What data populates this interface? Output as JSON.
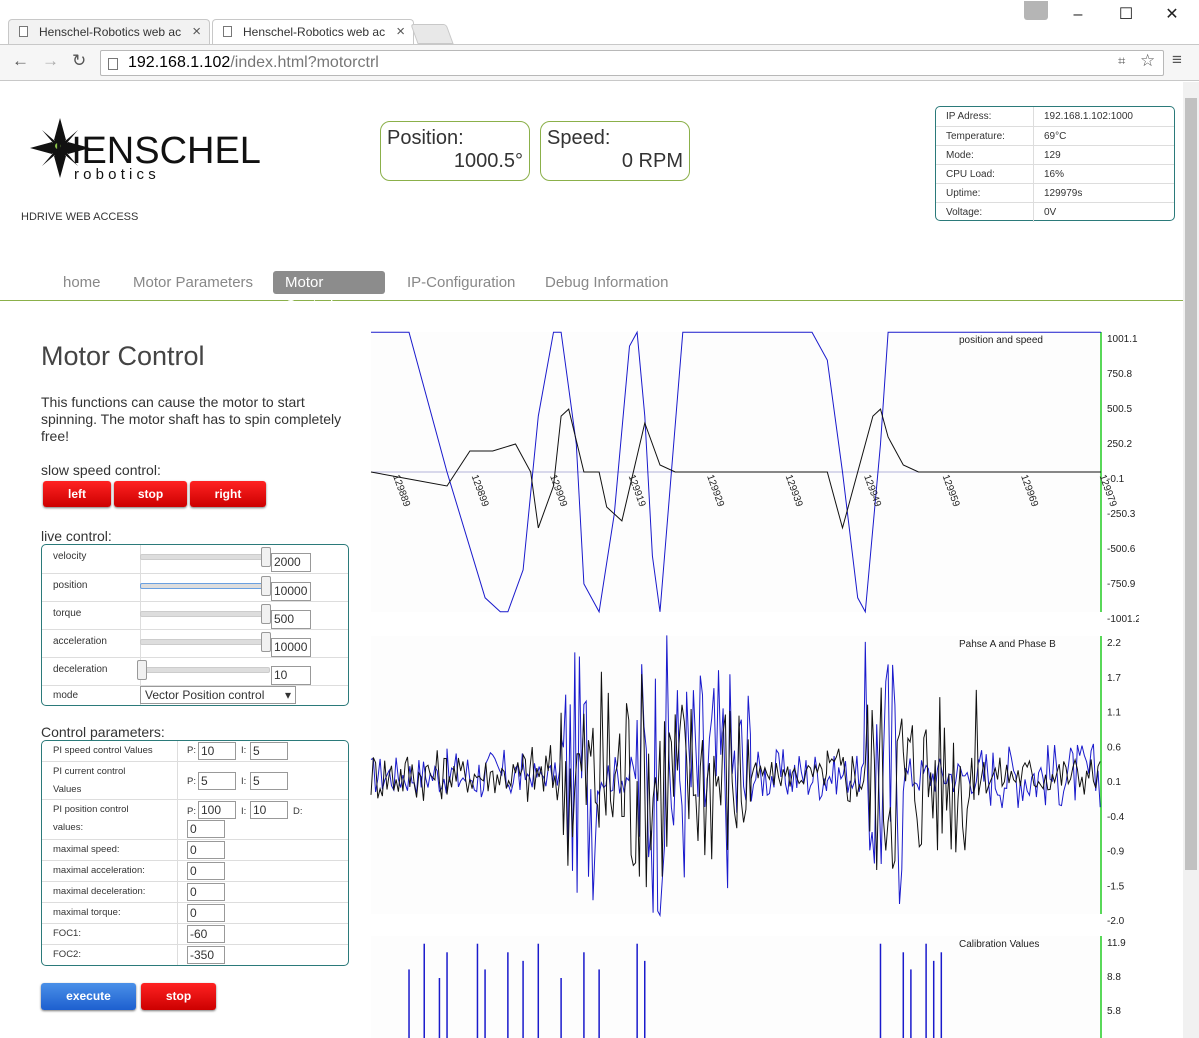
{
  "browser": {
    "tabs": [
      {
        "title": "Henschel-Robotics web ac"
      },
      {
        "title": "Henschel-Robotics web ac"
      }
    ],
    "url_host": "192.168.1.102",
    "url_path": "/index.html?motorctrl"
  },
  "header": {
    "logo_main": "HENSCHEL",
    "logo_sub": "r o b o t i c s",
    "subtitle": "HDRIVE WEB ACCESS",
    "position_label": "Position:",
    "position_value": "1000.5°",
    "speed_label": "Speed:",
    "speed_value": "0 RPM"
  },
  "status": [
    {
      "key": "IP Adress:",
      "value": "192.168.1.102:1000"
    },
    {
      "key": "Temperature:",
      "value": "69°C"
    },
    {
      "key": "Mode:",
      "value": "129"
    },
    {
      "key": "CPU Load:",
      "value": "16%"
    },
    {
      "key": "Uptime:",
      "value": "129979s"
    },
    {
      "key": "Voltage:",
      "value": "0V"
    }
  ],
  "menu": [
    "home",
    "Motor Parameters",
    "Motor Control",
    "IP-Configuration",
    "Debug Information"
  ],
  "main": {
    "title": "Motor Control",
    "description": "This functions can cause the motor to start spinning. The motor shaft has to spin completely free!",
    "slow_speed_label": "slow speed control:",
    "btn_left": "left",
    "btn_stop": "stop",
    "btn_right": "right",
    "live_label": "live control:",
    "live": [
      {
        "label": "velocity",
        "value": "2000",
        "level": 1.0
      },
      {
        "label": "position",
        "value": "10000",
        "level": 1.0
      },
      {
        "label": "torque",
        "value": "500",
        "level": 1.0
      },
      {
        "label": "acceleration",
        "value": "10000",
        "level": 1.0
      },
      {
        "label": "deceleration",
        "value": "10",
        "level": 0.0
      }
    ],
    "mode_label": "mode",
    "mode_value": "Vector Position control",
    "control_label": "Control parameters:",
    "pi_speed_label": "PI speed control Values",
    "pi_speed_p": "10",
    "pi_speed_i": "5",
    "pi_current_label": "PI current control Values",
    "pi_current_p": "5",
    "pi_current_i": "5",
    "pi_position_label": "PI position control values:",
    "pi_position_p": "100",
    "pi_position_i": "10",
    "pi_position_d": "0",
    "p_label": "P:",
    "i_label": "I:",
    "d_label": "D:",
    "params": [
      {
        "label": "maximal speed:",
        "value": "0"
      },
      {
        "label": "maximal acceleration:",
        "value": "0"
      },
      {
        "label": "maximal deceleration:",
        "value": "0"
      },
      {
        "label": "maximal torque:",
        "value": "0"
      },
      {
        "label": "FOC1:",
        "value": "-60"
      },
      {
        "label": "FOC2:",
        "value": "-350"
      }
    ],
    "execute": "execute",
    "stop": "stop"
  },
  "chart_data": [
    {
      "type": "line",
      "title": "position and speed",
      "x_ticks": [
        "129889",
        "129899",
        "129909",
        "129919",
        "129929",
        "129939",
        "129949",
        "129959",
        "129969",
        "129979"
      ],
      "y_ticks": [
        "1001.1",
        "750.8",
        "500.5",
        "250.2",
        "-0.1",
        "-250.3",
        "-500.6",
        "-750.9",
        "-1001.2"
      ],
      "ylim": [
        -1001.2,
        1001.1
      ],
      "series": [
        {
          "color": "#1a1acc",
          "x": [
            0,
            5,
            10,
            15,
            17,
            18,
            20,
            22,
            24,
            25,
            27,
            28,
            30,
            32,
            34,
            35,
            36,
            37,
            38,
            41,
            53,
            58,
            60,
            62,
            64,
            65,
            67,
            68,
            70,
            73,
            89,
            94,
            95,
            96
          ],
          "y": [
            1000,
            1000,
            0,
            -900,
            -1000,
            -1000,
            -700,
            400,
            1000,
            1000,
            200,
            -800,
            -1000,
            -300,
            900,
            1000,
            400,
            -600,
            -1000,
            1000,
            1000,
            1000,
            800,
            0,
            -900,
            -1000,
            200,
            1000,
            1000,
            1000,
            1000,
            1000,
            1000,
            1000
          ]
        },
        {
          "color": "#111111",
          "x": [
            0,
            5,
            10,
            13,
            16,
            19,
            21,
            22,
            24,
            25,
            26,
            28,
            30,
            31,
            33,
            36,
            38,
            40,
            50,
            60,
            62,
            63,
            66,
            67,
            68,
            70,
            72,
            80,
            96
          ],
          "y": [
            -0.1,
            -50,
            -100,
            150,
            150,
            200,
            -0.1,
            -400,
            -100,
            400,
            450,
            0,
            -0.1,
            -250,
            -350,
            350,
            50,
            -0.1,
            -0.1,
            -0.1,
            -400,
            -200,
            400,
            450,
            250,
            50,
            -0.1,
            -0.1,
            -0.1
          ]
        }
      ]
    },
    {
      "type": "line",
      "title": "Pahse A and Phase B",
      "y_ticks": [
        "2.2",
        "1.7",
        "1.1",
        "0.6",
        "0.1",
        "-0.4",
        "-0.9",
        "-1.5",
        "-2.0"
      ],
      "ylim": [
        -2.0,
        2.2
      ],
      "series": [
        {
          "color": "#1a1acc",
          "x": [
            0,
            10,
            20,
            25,
            30,
            35,
            40,
            50,
            60,
            65,
            70,
            80,
            96
          ],
          "y": [
            0.1,
            0.2,
            0.0,
            1.7,
            0.1,
            2.0,
            -1.6,
            0.2,
            -0.1,
            1.9,
            0.1,
            0.3,
            0.1
          ]
        },
        {
          "color": "#111111",
          "x": [
            0,
            10,
            20,
            25,
            30,
            35,
            40,
            50,
            60,
            65,
            70,
            80,
            96
          ],
          "y": [
            0.2,
            -0.1,
            0.3,
            -1.2,
            1.6,
            -1.5,
            1.2,
            0.0,
            0.3,
            -1.4,
            1.1,
            -0.1,
            0.0
          ]
        }
      ]
    },
    {
      "type": "bar",
      "title": "Calibration Values",
      "y_ticks": [
        "11.9",
        "8.8",
        "5.8"
      ],
      "ylim": [
        0,
        11.9
      ],
      "series": [
        {
          "color": "#1a1acc",
          "x": [
            5,
            7,
            9,
            10,
            14,
            15,
            18,
            20,
            22,
            25,
            28,
            30,
            35,
            36,
            67,
            70,
            71,
            73,
            74,
            75
          ],
          "y": [
            8,
            11,
            7,
            10,
            11,
            8,
            10,
            9,
            11,
            7,
            10,
            8,
            11,
            9,
            11,
            10,
            8,
            11,
            9,
            10
          ]
        }
      ]
    }
  ]
}
